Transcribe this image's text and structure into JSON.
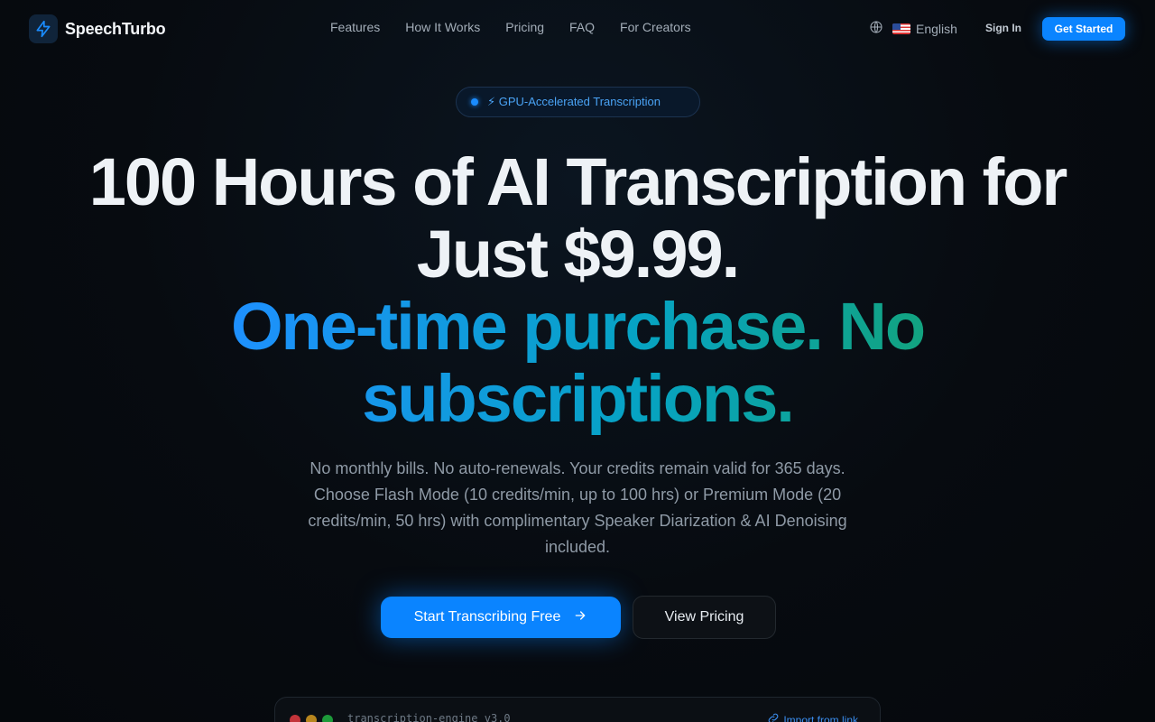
{
  "brand": {
    "name": "SpeechTurbo",
    "logo_icon": "lightning-icon",
    "accent": "#0a84ff"
  },
  "nav": {
    "links": [
      "Features",
      "How It Works",
      "Pricing",
      "FAQ",
      "For Creators"
    ],
    "language": "English",
    "sign_in": "Sign In",
    "get_started": "Get Started"
  },
  "hero": {
    "badge": "⚡ GPU-Accelerated Transcription",
    "title_line1": "100 Hours of AI Transcription for",
    "title_line2": "Just $9.99.",
    "title_grad1": "One-time purchase. No",
    "title_grad2": "subscriptions.",
    "subtitle": "No monthly bills. No auto-renewals. Your credits remain valid for 365 days. Choose Flash Mode (10 credits/min, up to 100 hrs) or Premium Mode (20 credits/min, 50 hrs) with complimentary Speaker Diarization & AI Denoising included.",
    "cta_primary": "Start Transcribing Free",
    "cta_secondary": "View Pricing"
  },
  "terminal": {
    "title": "transcription-engine v3.0",
    "link": "Import from link",
    "dot_colors": [
      "#e0443e",
      "#dea123",
      "#1aab29"
    ]
  }
}
